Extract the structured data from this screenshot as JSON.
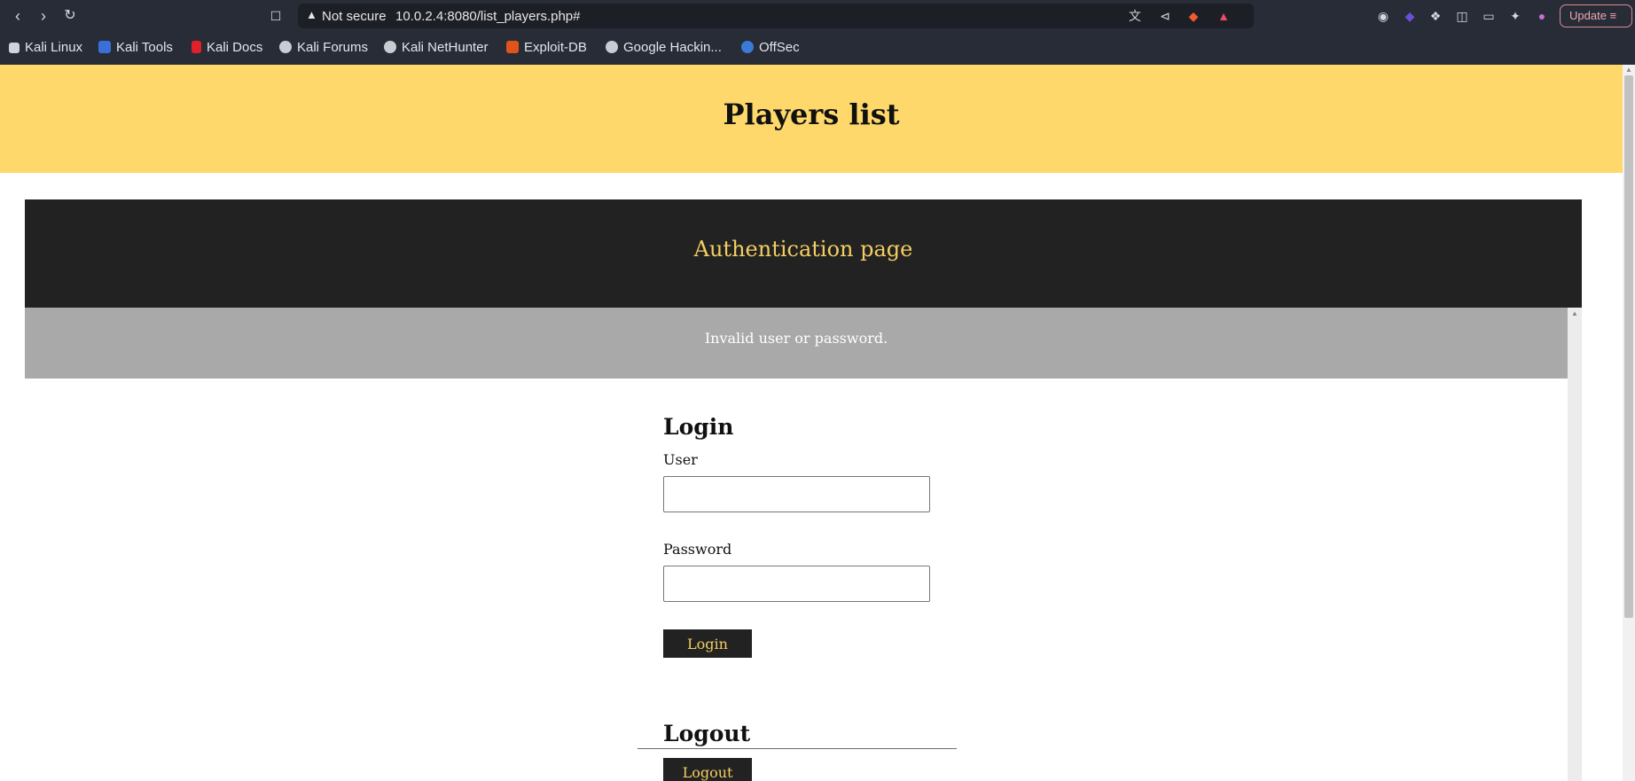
{
  "browser": {
    "nav": {
      "back_icon": "chevron-left-icon",
      "forward_icon": "chevron-right-icon",
      "reload_icon": "reload-icon",
      "bookmark_icon": "bookmark-icon"
    },
    "address": {
      "security_label": "Not secure",
      "url": "10.0.2.4:8080/list_players.php#"
    },
    "update_label": "Update",
    "bookmarks": [
      {
        "label": "Kali Linux",
        "color": "#d0d4dc"
      },
      {
        "label": "Kali Tools",
        "color": "#3b6fd8"
      },
      {
        "label": "Kali Docs",
        "color": "#e0212a"
      },
      {
        "label": "Kali Forums",
        "color": "#c9ccd3"
      },
      {
        "label": "Kali NetHunter",
        "color": "#c9ccd3"
      },
      {
        "label": "Exploit-DB",
        "color": "#e0541c"
      },
      {
        "label": "Google Hackin...",
        "color": "#c9ccd3"
      },
      {
        "label": "OffSec",
        "color": "#3a7bd5"
      }
    ]
  },
  "page": {
    "title": "Players list",
    "auth_title": "Authentication page",
    "alert": "Invalid user or password.",
    "login": {
      "heading": "Login",
      "user_label": "User",
      "user_value": "",
      "password_label": "Password",
      "password_value": "",
      "button": "Login"
    },
    "logout": {
      "heading": "Logout",
      "button": "Logout"
    }
  },
  "colors": {
    "hero_bg": "#fed86a",
    "dark_bg": "#222222",
    "accent_text": "#f4ce63",
    "alert_bg": "#a9a9a9"
  }
}
